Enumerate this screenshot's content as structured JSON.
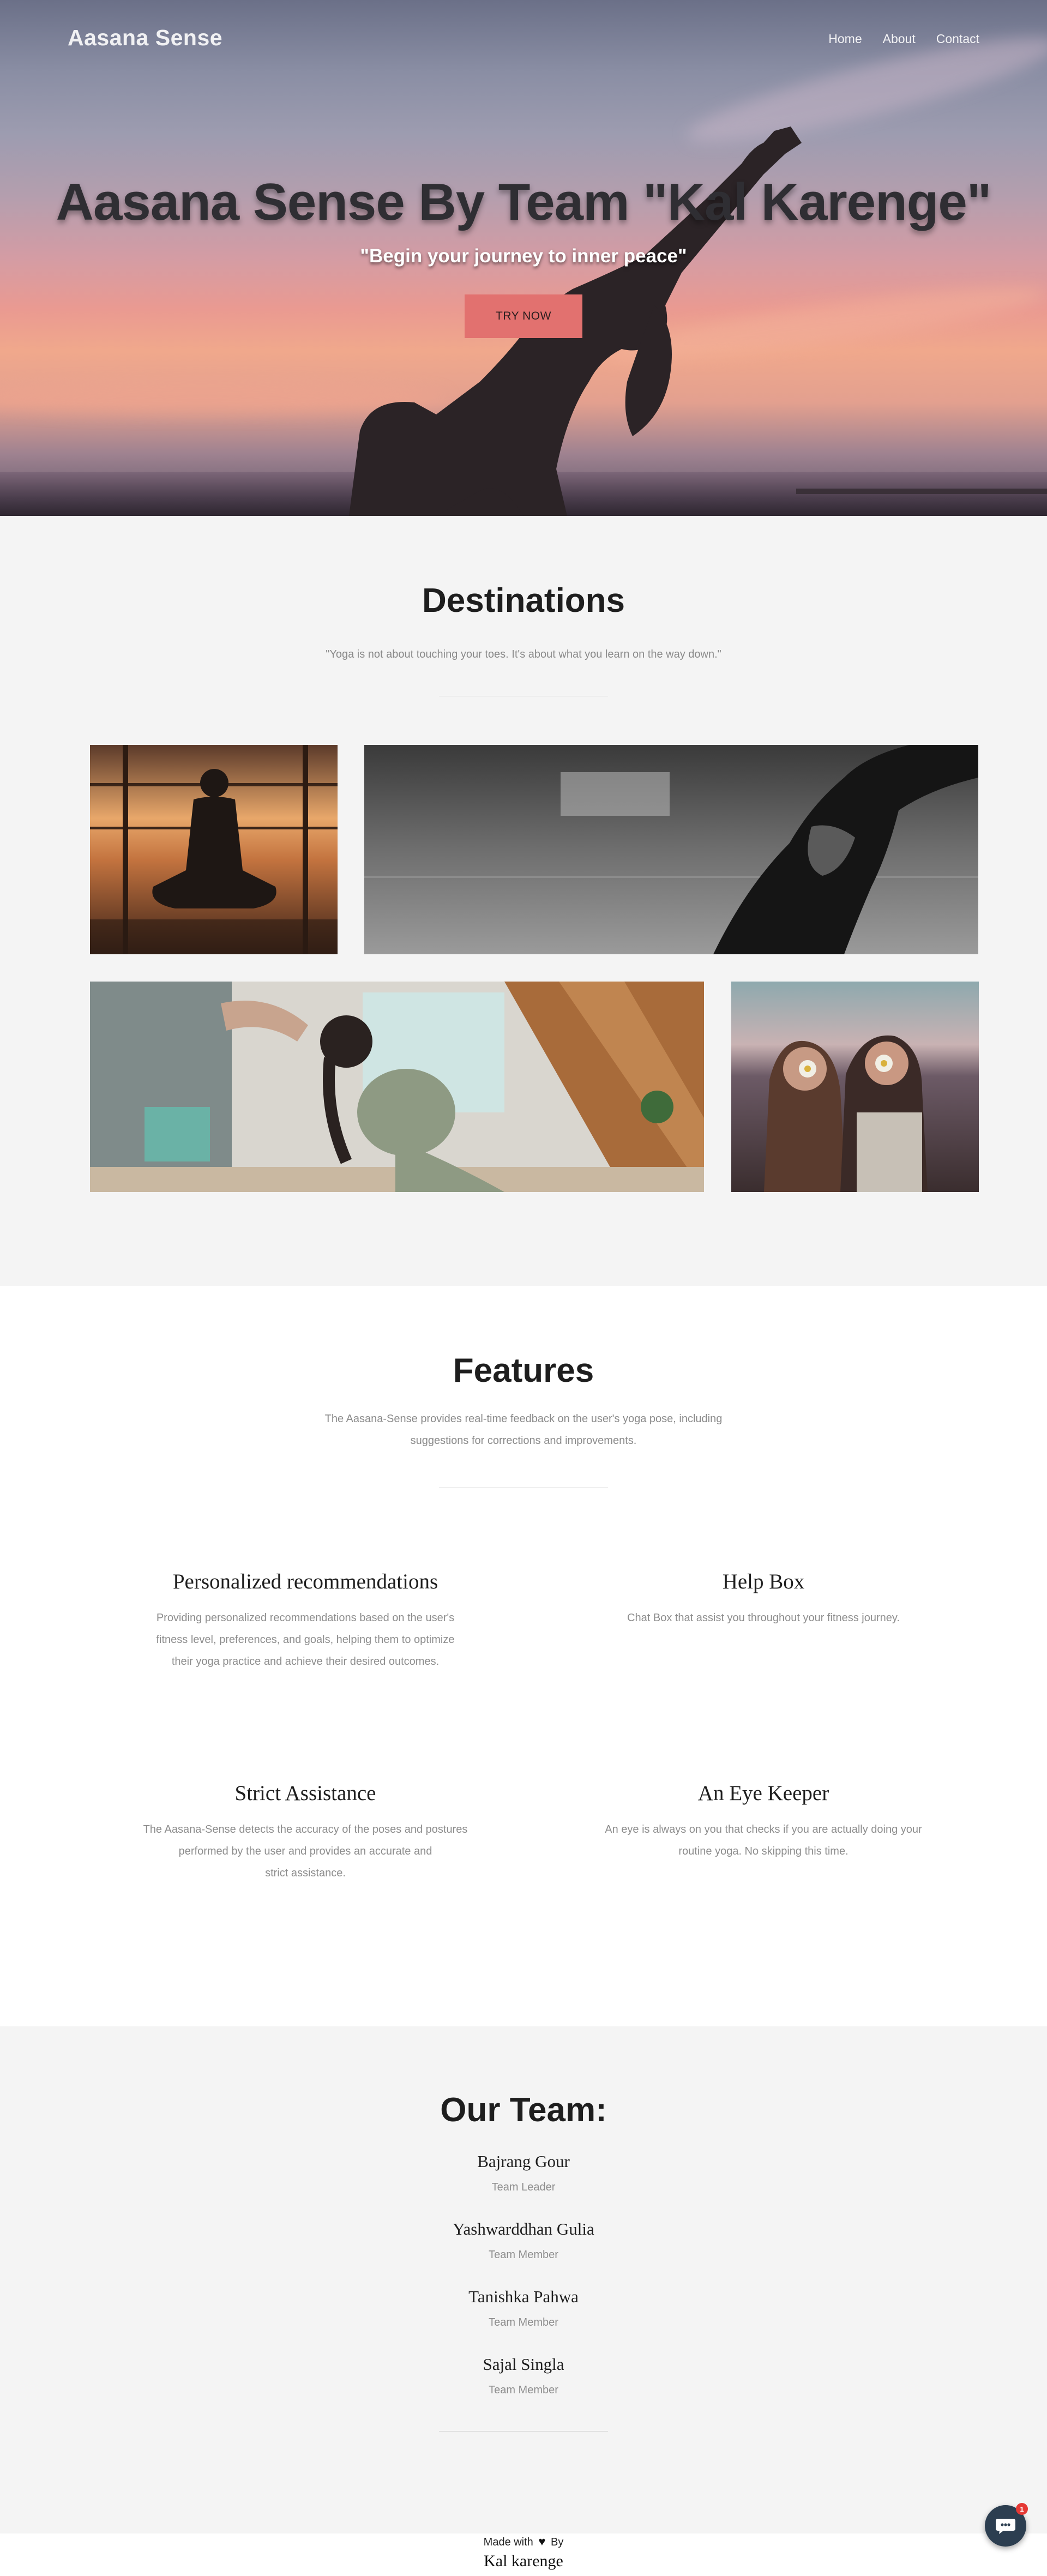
{
  "header": {
    "brand": "Aasana Sense",
    "nav": [
      "Home",
      "About",
      "Contact"
    ]
  },
  "hero": {
    "title": "Aasana Sense By Team \"Kal Karenge\"",
    "subtitle": "\"Begin your journey to inner peace\"",
    "cta_label": "TRY NOW",
    "cta_color": "#e2716f"
  },
  "destinations": {
    "title": "Destinations",
    "quote": "\"Yoga is not about touching your toes. It's about what you learn on the way down.\""
  },
  "features": {
    "title": "Features",
    "intro_line1": "The Aasana-Sense provides real-time feedback on the user's yoga pose, including",
    "intro_line2": "suggestions for corrections and improvements.",
    "items": [
      {
        "title": "Personalized recommendations",
        "lines": [
          "Providing personalized recommendations based on the user's",
          "fitness level, preferences, and goals, helping them to optimize",
          "their yoga practice and achieve their desired outcomes."
        ]
      },
      {
        "title": "Help Box",
        "lines": [
          "Chat Box that assist you throughout your fitness journey."
        ]
      },
      {
        "title": "Strict Assistance",
        "lines": [
          "The Aasana-Sense detects the accuracy of the poses and postures",
          "performed by the user and provides an accurate and",
          "strict assistance."
        ]
      },
      {
        "title": "An Eye Keeper",
        "lines": [
          "An eye is always on you that checks if you are actually doing your",
          "routine yoga. No skipping this time."
        ]
      }
    ]
  },
  "team": {
    "title": "Our Team:",
    "members": [
      {
        "name": "Bajrang Gour",
        "role": "Team Leader"
      },
      {
        "name": "Yashwarddhan Gulia",
        "role": "Team Member"
      },
      {
        "name": "Tanishka Pahwa",
        "role": "Team Member"
      },
      {
        "name": "Sajal Singla",
        "role": "Team Member"
      }
    ]
  },
  "footer": {
    "made_with": "Made with",
    "by": "By",
    "team_name": "Kal karenge"
  },
  "chat_widget": {
    "badge_count": "1",
    "icon": "chat-bubble-icon"
  },
  "colors": {
    "accent": "#e2716f",
    "title": "#1e1e1e",
    "muted": "#8d8d8d",
    "section_bg": "#f4f4f4"
  }
}
